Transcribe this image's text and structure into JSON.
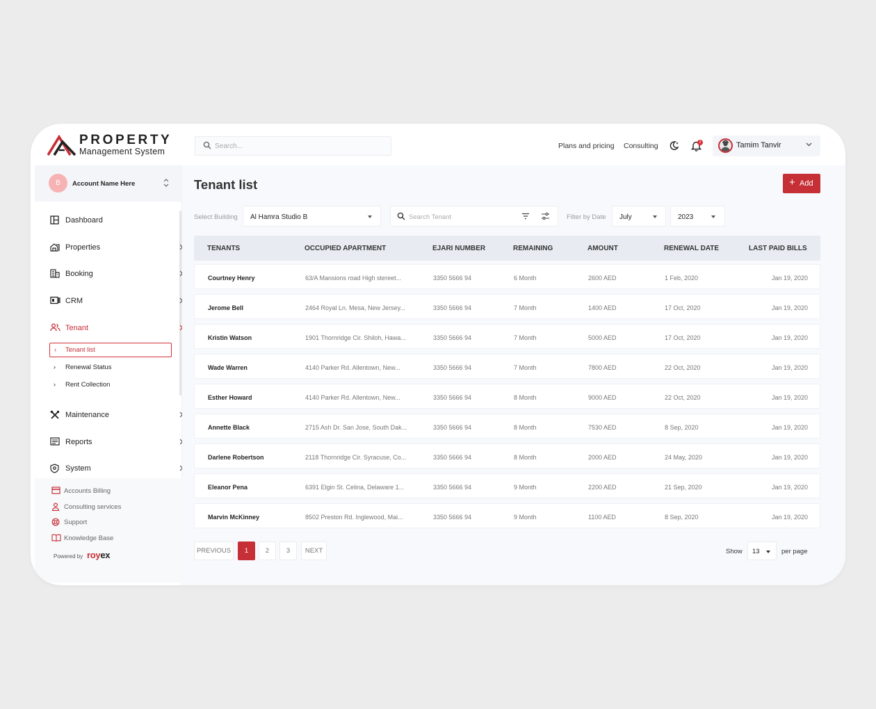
{
  "brand": {
    "line1": "PROPERTY",
    "line2": "Management System",
    "accent": "#c62f36"
  },
  "header": {
    "search_placeholder": "Search...",
    "links": [
      "Plans and pricing",
      "Consulting"
    ],
    "notification_count": "2",
    "user_name": "Tamim Tanvir"
  },
  "sidebar": {
    "account": {
      "initial": "B",
      "name": "Account Name Here"
    },
    "items": [
      {
        "label": "Dashboard"
      },
      {
        "label": "Properties"
      },
      {
        "label": "Booking"
      },
      {
        "label": "CRM"
      },
      {
        "label": "Tenant"
      },
      {
        "label": "Maintenance"
      },
      {
        "label": "Reports"
      },
      {
        "label": "System"
      }
    ],
    "tenant_sub": [
      "Tenant list",
      "Renewal Status",
      "Rent Collection"
    ],
    "system_sub": [
      "Accounts Billing",
      "Consulting services",
      "Support",
      "Knowledge Base"
    ],
    "powered_by": "Powered by",
    "powered_logo_a": "roy",
    "powered_logo_b": "ex"
  },
  "main": {
    "title": "Tenant list",
    "add_label": "Add",
    "filters": {
      "building_label": "Select Building",
      "building_value": "Al Hamra Studio B",
      "search_placeholder": "Search Tenant",
      "date_label": "Filter by  Date",
      "month": "July",
      "year": "2023"
    },
    "table": {
      "columns": [
        "TENANTS",
        "OCCUPIED APARTMENT",
        "EJARI NUMBER",
        "REMAINING",
        "AMOUNT",
        "RENEWAL DATE",
        "LAST PAID BILLS"
      ],
      "rows": [
        [
          "Courtney Henry",
          "63/A Mansions road High stereet...",
          "3350 5666 94",
          "6 Month",
          "2600 AED",
          "1 Feb, 2020",
          "Jan 19, 2020"
        ],
        [
          "Jerome Bell",
          "2464 Royal Ln. Mesa, New Jersey...",
          "3350 5666 94",
          "7 Month",
          "1400 AED",
          "17 Oct, 2020",
          "Jan 19, 2020"
        ],
        [
          "Kristin Watson",
          "1901 Thornridge Cir. Shiloh, Hawa...",
          "3350 5666 94",
          "7 Month",
          "5000 AED",
          "17 Oct, 2020",
          "Jan 19, 2020"
        ],
        [
          "Wade Warren",
          "4140 Parker Rd. Allentown, New...",
          "3350 5666 94",
          "7 Month",
          "7800 AED",
          "22 Oct, 2020",
          "Jan 19, 2020"
        ],
        [
          "Esther Howard",
          "4140 Parker Rd. Allentown, New...",
          "3350 5666 94",
          "8 Month",
          "9000 AED",
          "22 Oct, 2020",
          "Jan 19, 2020"
        ],
        [
          "Annette Black",
          "2715 Ash Dr. San Jose, South Dak...",
          "3350 5666 94",
          "8 Month",
          "7530 AED",
          "8 Sep, 2020",
          "Jan 19, 2020"
        ],
        [
          "Darlene Robertson",
          "2118 Thornridge Cir. Syracuse, Co...",
          "3350 5666 94",
          "8 Month",
          "2000 AED",
          "24 May, 2020",
          "Jan 19, 2020"
        ],
        [
          "Eleanor Pena",
          "6391 Elgin St. Celina, Delaware 1...",
          "3350 5666 94",
          "9 Month",
          "2200 AED",
          "21 Sep, 2020",
          "Jan 19, 2020"
        ],
        [
          "Marvin McKinney",
          "8502 Preston Rd. Inglewood, Mai...",
          "3350 5666 94",
          "9 Month",
          "1100 AED",
          "8 Sep, 2020",
          "Jan 19, 2020"
        ]
      ]
    },
    "pagination": {
      "prev": "PREVIOUS",
      "pages": [
        "1",
        "2",
        "3"
      ],
      "next": "NEXT",
      "show_label": "Show",
      "per_page_value": "13",
      "per_page_label": "per page"
    }
  }
}
